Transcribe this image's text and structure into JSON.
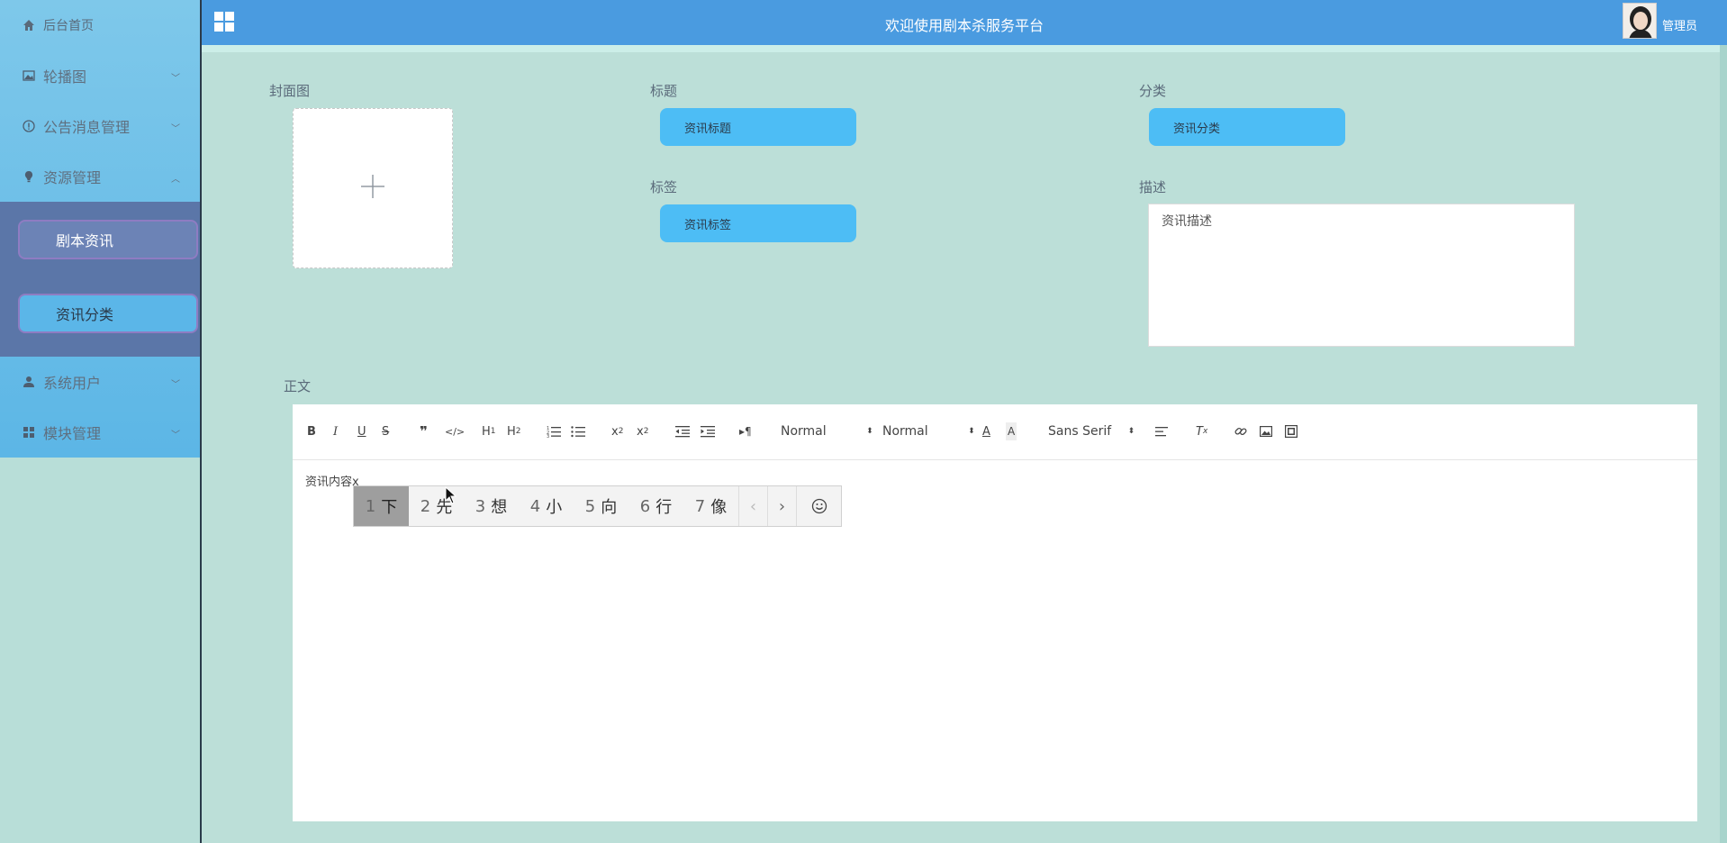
{
  "app": {
    "title": "欢迎使用剧本杀服务平台",
    "user": "管理员",
    "colors": {
      "header": "#4a9be0",
      "accent": "#4dbdf5",
      "sidebar_sub": "#5b76a8"
    }
  },
  "sidebar": {
    "home": "后台首页",
    "items": [
      {
        "label": "轮播图",
        "icon": "image-icon"
      },
      {
        "label": "公告消息管理",
        "icon": "info-circle-icon"
      },
      {
        "label": "资源管理",
        "icon": "bulb-icon"
      },
      {
        "label": "系统用户",
        "icon": "user-icon"
      },
      {
        "label": "模块管理",
        "icon": "grid-icon"
      }
    ],
    "sub_items": [
      "剧本资讯",
      "资讯分类"
    ]
  },
  "form": {
    "cover_label": "封面图",
    "title_label": "标题",
    "title_value": "资讯标题",
    "category_label": "分类",
    "category_value": "资讯分类",
    "tags_label": "标签",
    "tags_value": "资讯标签",
    "desc_label": "描述",
    "desc_value": "资讯描述",
    "body_label": "正文"
  },
  "editor": {
    "header_select": "Normal",
    "size_select": "Normal",
    "font_select": "Sans Serif",
    "content": "资讯内容x"
  },
  "ime": {
    "candidates": [
      {
        "n": "1",
        "c": "下"
      },
      {
        "n": "2",
        "c": "先"
      },
      {
        "n": "3",
        "c": "想"
      },
      {
        "n": "4",
        "c": "小"
      },
      {
        "n": "5",
        "c": "向"
      },
      {
        "n": "6",
        "c": "行"
      },
      {
        "n": "7",
        "c": "像"
      }
    ],
    "prev": "‹",
    "next": "›"
  }
}
